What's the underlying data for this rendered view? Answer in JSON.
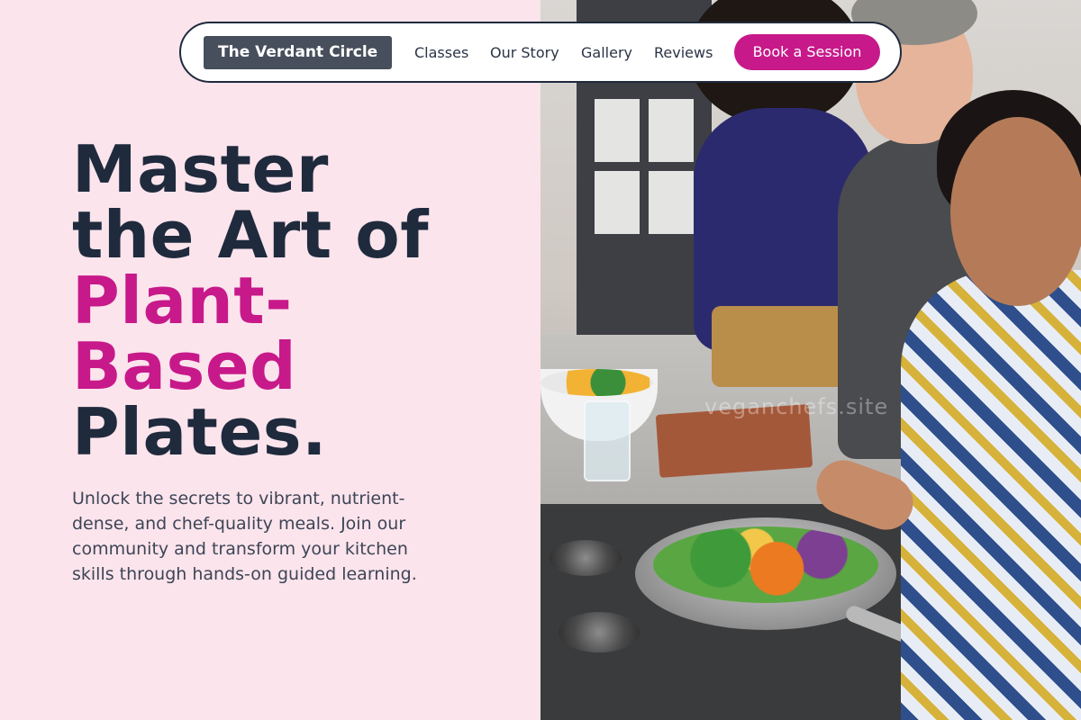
{
  "nav": {
    "brand": "The Verdant Circle",
    "links": [
      "Classes",
      "Our Story",
      "Gallery",
      "Reviews"
    ],
    "cta": "Book a Session"
  },
  "hero": {
    "headline_line1": "Master",
    "headline_line2": "the Art of",
    "headline_accent_line1": "Plant-",
    "headline_accent_line2": "Based",
    "headline_line3": "Plates.",
    "description": "Unlock the secrets to vibrant, nutrient-dense, and chef-quality meals. Join our community and transform your kitchen skills through hands-on guided learning."
  },
  "photo": {
    "watermark": "veganchefs.site"
  },
  "colors": {
    "background": "#fbe4ec",
    "headline": "#1f2a3d",
    "accent": "#c7198a",
    "brand_badge": "#474e5c"
  }
}
